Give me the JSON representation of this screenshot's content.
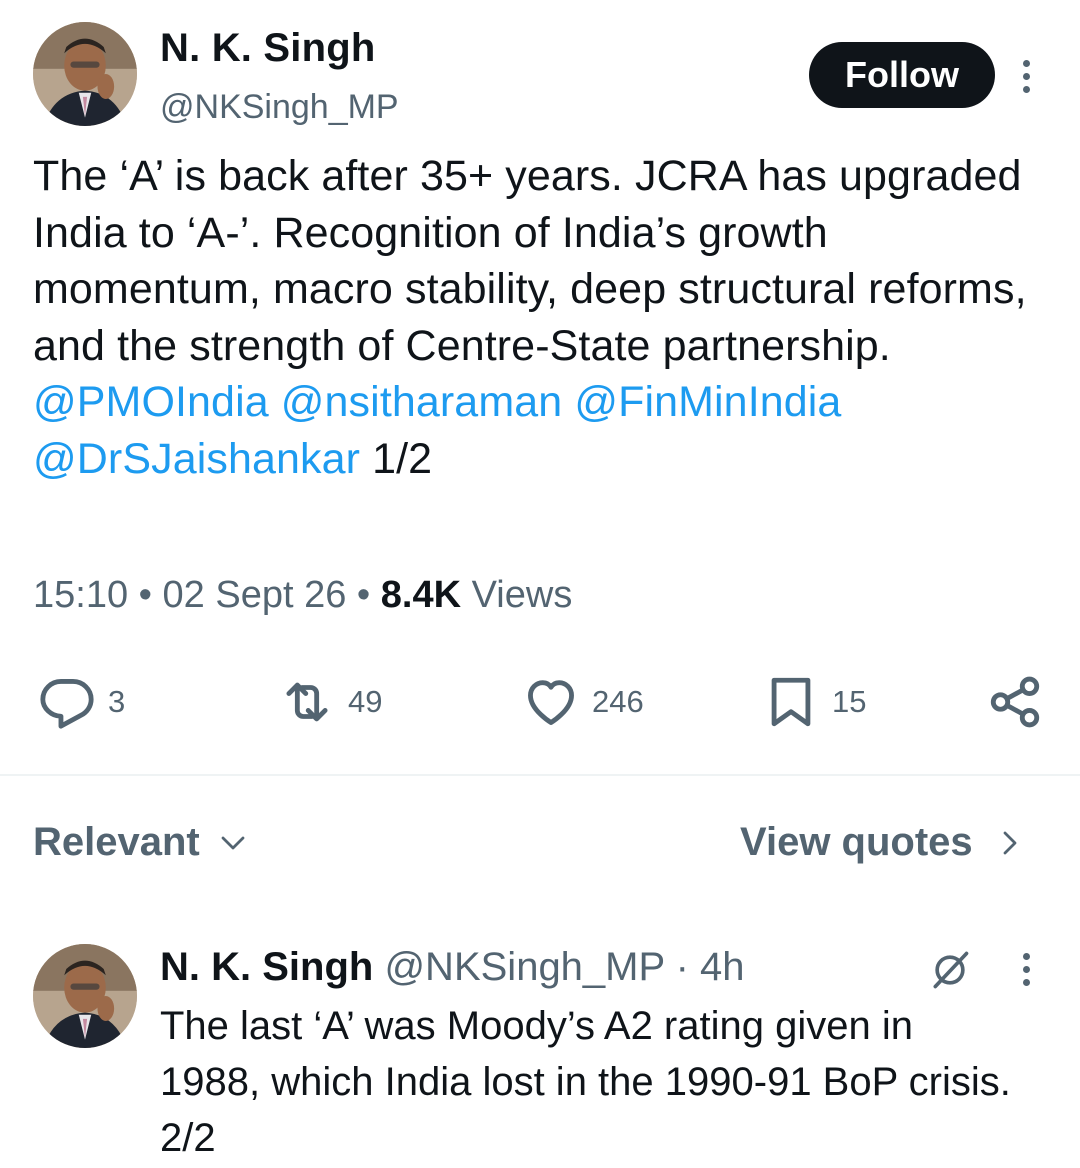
{
  "tweet": {
    "author_name": "N. K. Singh",
    "author_handle": "@NKSingh_MP",
    "follow_label": "Follow",
    "text": "The ‘A’ is back after 35+ years. JCRA has upgraded India to ‘A-’. Recognition of India’s growth momentum, macro stability, deep structural reforms, and the strength of Centre-State partnership.",
    "mentions": [
      "@PMOIndia",
      "@nsitharaman",
      "@FinMinIndia",
      "@DrSJaishankar"
    ],
    "thread_marker": "1/2",
    "time": "15:10",
    "date": "02 Sept 26",
    "views_count": "8.4K",
    "views_label": "Views",
    "separator": "•"
  },
  "actions": {
    "replies": "3",
    "retweets": "49",
    "likes": "246",
    "bookmarks": "15"
  },
  "filters": {
    "sort_label": "Relevant",
    "quotes_label": "View quotes"
  },
  "reply": {
    "author_name": "N. K. Singh",
    "author_handle": "@NKSingh_MP",
    "dot": "·",
    "time": "4h",
    "text": "The last ‘A’ was Moody’s A2 rating given in 1988, which India lost in the 1990-91 BoP crisis. 2/2"
  },
  "colors": {
    "text": "#0f1419",
    "secondary": "#536471",
    "link": "#1d9bf0",
    "button": "#0f1419"
  },
  "icons": [
    "reply-icon",
    "retweet-icon",
    "like-icon",
    "bookmark-icon",
    "share-icon",
    "chevron-down-icon",
    "chevron-right-icon",
    "grok-icon",
    "more-icon"
  ]
}
